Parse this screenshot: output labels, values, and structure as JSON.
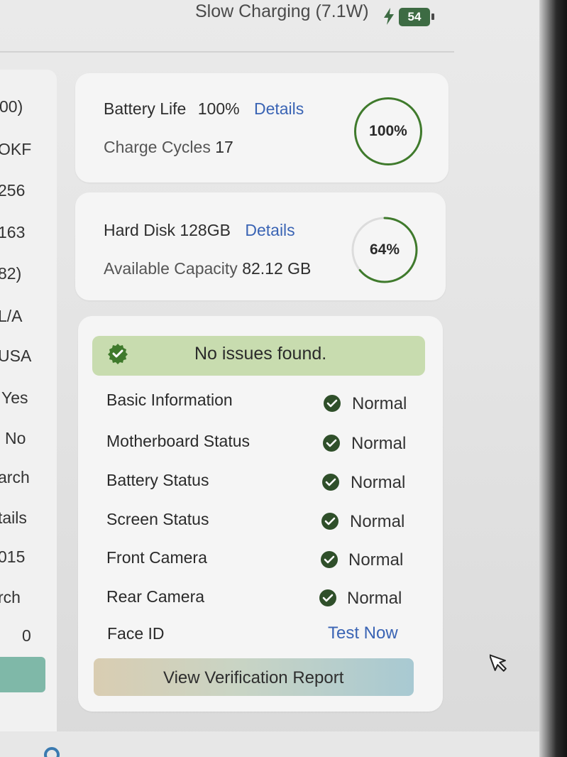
{
  "status_bar": {
    "charging_text": "Slow Charging (7.1W)",
    "battery_percent": "54",
    "bolt_icon": "lightning-icon"
  },
  "left_column": {
    "values": [
      "00)",
      "OKF",
      "256",
      "163",
      "82)",
      "L/A",
      "USA",
      "Yes",
      "No",
      "arch",
      "tails",
      "015",
      "rch",
      "0"
    ]
  },
  "battery_card": {
    "label": "Battery Life",
    "value": "100%",
    "link": "Details",
    "cycles_label": "Charge Cycles",
    "cycles_value": "17",
    "ring_text": "100%",
    "ring_fraction": 1.0
  },
  "disk_card": {
    "label": "Hard Disk 128GB",
    "link": "Details",
    "capacity_label": "Available Capacity",
    "capacity_value": "82.12 GB",
    "ring_text": "64%",
    "ring_fraction": 0.64
  },
  "status_card": {
    "banner_text": "No issues found.",
    "rows": [
      {
        "label": "Basic Information",
        "status": "Normal"
      },
      {
        "label": "Motherboard Status",
        "status": "Normal"
      },
      {
        "label": "Battery Status",
        "status": "Normal"
      },
      {
        "label": "Screen Status",
        "status": "Normal"
      },
      {
        "label": "Front Camera",
        "status": "Normal"
      },
      {
        "label": "Rear Camera",
        "status": "Normal"
      },
      {
        "label": "Face ID",
        "status": ""
      }
    ],
    "face_id_action": "Test Now",
    "report_button": "View Verification Report"
  },
  "colors": {
    "accent_green": "#3f7a2c",
    "banner_green": "#c8dcaf",
    "link_blue": "#3a64b4",
    "badge_green": "#3d6b43"
  }
}
